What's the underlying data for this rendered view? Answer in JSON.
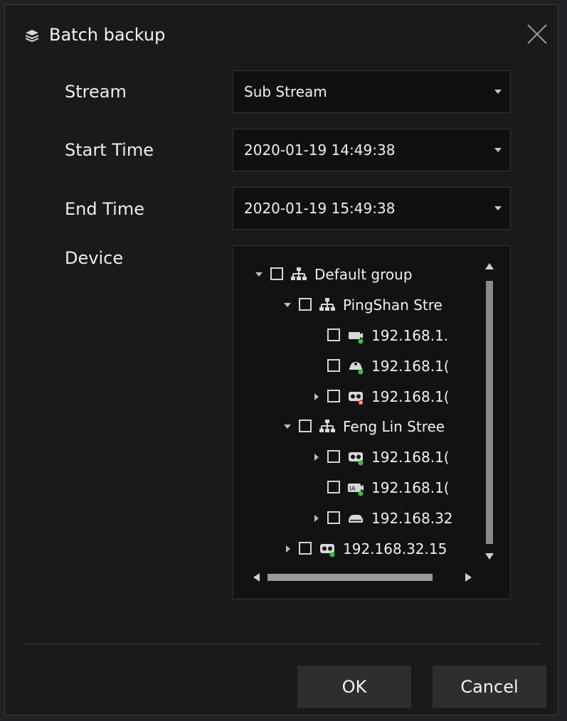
{
  "dialog": {
    "title": "Batch backup",
    "title_icon": "layers-icon",
    "close_icon": "close-icon"
  },
  "form": {
    "stream_label": "Stream",
    "stream_value": "Sub Stream",
    "start_label": "Start Time",
    "start_value": "2020-01-19 14:49:38",
    "end_label": "End Time",
    "end_value": "2020-01-19 15:49:38",
    "device_label": "Device"
  },
  "tree": [
    {
      "label": "Default group",
      "icon": "group-icon",
      "expander": "down"
    },
    {
      "label": "PingShan Stre",
      "icon": "group-icon",
      "expander": "down"
    },
    {
      "label": "192.168.1.",
      "icon": "bullet-camera-icon",
      "expander": "none",
      "status": "online"
    },
    {
      "label": "192.168.1(",
      "icon": "dome-camera-icon",
      "expander": "none",
      "status": "online"
    },
    {
      "label": "192.168.1(",
      "icon": "nvr-icon",
      "expander": "right",
      "status": "offline"
    },
    {
      "label": "Feng Lin Stree",
      "icon": "group-icon",
      "expander": "down"
    },
    {
      "label": "192.168.1(",
      "icon": "nvr-icon",
      "expander": "right",
      "status": "online"
    },
    {
      "label": "192.168.1(",
      "icon": "ia-camera-icon",
      "expander": "none",
      "status": "online"
    },
    {
      "label": "192.168.32",
      "icon": "recorder-icon",
      "expander": "right"
    },
    {
      "label": "192.168.32.15",
      "icon": "nvr-icon",
      "expander": "right",
      "status": "online"
    }
  ],
  "buttons": {
    "ok": "OK",
    "cancel": "Cancel"
  },
  "colors": {
    "background": "#1a1a1c",
    "field_bg": "#101012",
    "online": "#3cc03c",
    "offline": "#d23a3a"
  }
}
